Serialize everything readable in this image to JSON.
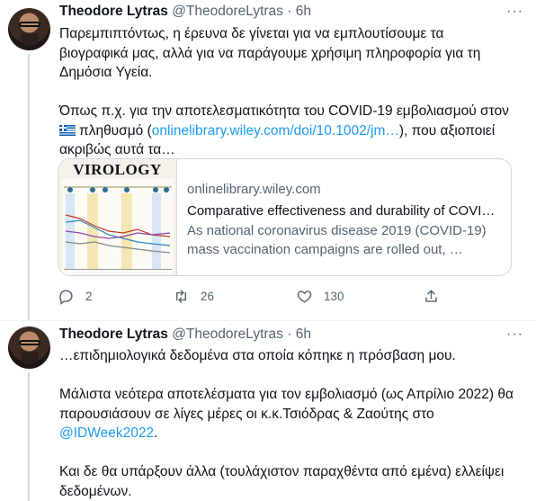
{
  "tweets": [
    {
      "author": "Theodore Lytras",
      "handle": "@TheodoreLytras",
      "dot": "·",
      "time": "6h",
      "lines": [
        "Παρεμπιπτόντως, η έρευνα δε γίνεται για να εμπλουτίσουμε τα",
        "βιογραφικά μας, αλλά για να παράγουμε χρήσιμη πληροφορία για τη",
        "Δημόσια Υγεία."
      ],
      "line4": "Όπως π.χ. για την αποτελεσματικότητα του COVID-19 εμβολιασμού στον",
      "line5_before": "πληθυσμό (",
      "line5_link": "onlinelibrary.wiley.com/doi/10.1002/jm…",
      "line5_after": "), που αξιοποιεί",
      "line6": "ακριβώς αυτά τα…",
      "card": {
        "journal": "VIROLOGY",
        "domain": "onlinelibrary.wiley.com",
        "title": "Comparative effectiveness and durability of COVI…",
        "desc1": "As national coronavirus disease 2019 (COVID-19)",
        "desc2": "mass vaccination campaigns are rolled out, …"
      },
      "actions": {
        "replies": "2",
        "retweets": "26",
        "likes": "130"
      }
    },
    {
      "author": "Theodore Lytras",
      "handle": "@TheodoreLytras",
      "dot": "·",
      "time": "6h",
      "line1": "…επιδημιολογικά δεδομένα στα οποία κόπηκε η πρόσβαση μου.",
      "line2": "Μάλιστα νεότερα αποτελέσματα για τον εμβολιασμό (ως Απρίλιο 2022) θα",
      "line3": "παρουσιάσουν σε λίγες μέρες οι κ.κ.Τσιόδρας & Ζαούτης στο",
      "line4_link": "@IDWeek2022",
      "line4_after": ".",
      "line5": "Και δε θα υπάρξουν άλλα (τουλάχιστον παραχθέντα από εμένα) ελλείψει",
      "line6": "δεδομένων."
    }
  ],
  "colors": {
    "link": "#1d9bf0",
    "muted": "#536471",
    "text": "#0f1419",
    "border": "#cfd9de"
  },
  "icons": [
    "more-icon",
    "reply-icon",
    "retweet-icon",
    "like-icon",
    "share-icon",
    "greek-flag-icon"
  ]
}
